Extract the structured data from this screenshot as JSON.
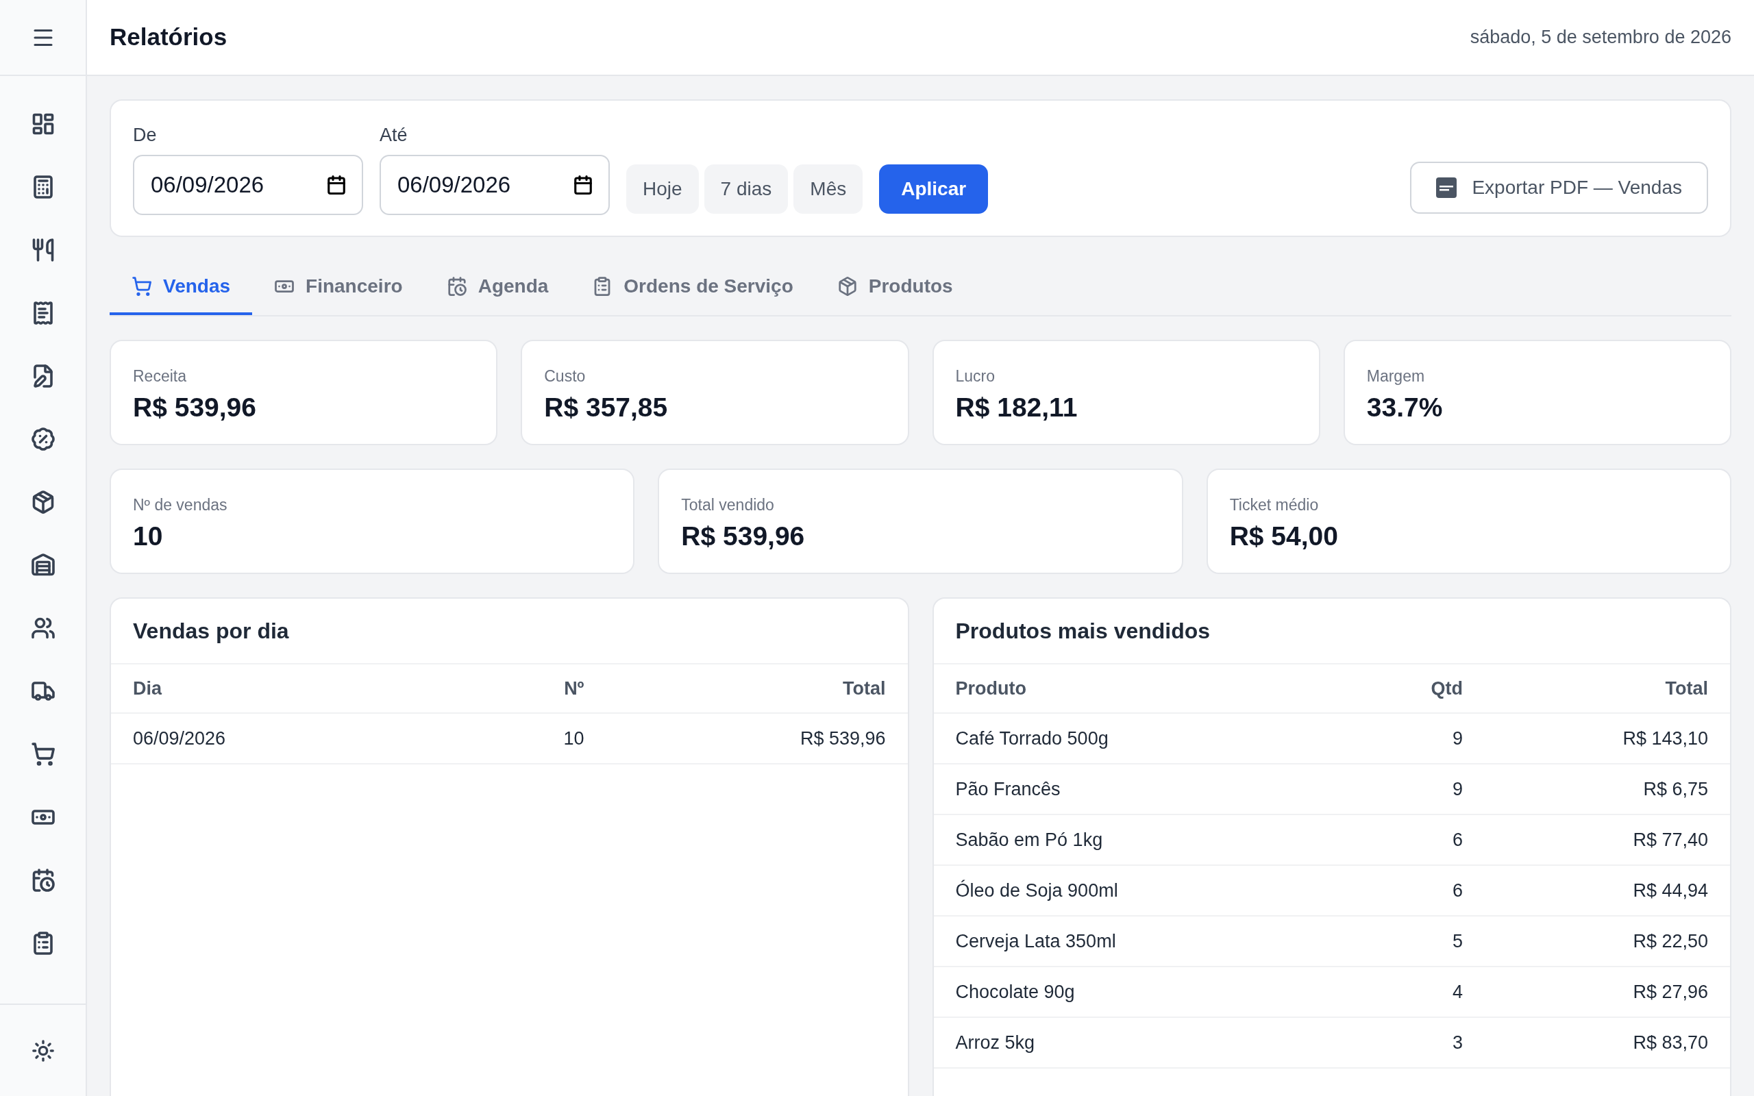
{
  "header": {
    "title": "Relatórios",
    "date": "sábado, 5 de setembro de 2026"
  },
  "filters": {
    "from": {
      "label": "De",
      "value": "06/09/2026"
    },
    "to": {
      "label": "Até",
      "value": "06/09/2026"
    },
    "presets": [
      "Hoje",
      "7 dias",
      "Mês"
    ],
    "apply": "Aplicar",
    "export": "Exportar PDF — Vendas"
  },
  "tabs": [
    {
      "label": "Vendas",
      "kind": "cart",
      "selected": true
    },
    {
      "label": "Financeiro",
      "kind": "money",
      "selected": false
    },
    {
      "label": "Agenda",
      "kind": "calendar",
      "selected": false
    },
    {
      "label": "Ordens de Serviço",
      "kind": "clipboard",
      "selected": false
    },
    {
      "label": "Produtos",
      "kind": "box",
      "selected": false
    }
  ],
  "kpis_top": [
    {
      "label": "Receita",
      "value": "R$ 539,96"
    },
    {
      "label": "Custo",
      "value": "R$ 357,85"
    },
    {
      "label": "Lucro",
      "value": "R$ 182,11"
    },
    {
      "label": "Margem",
      "value": "33.7%"
    }
  ],
  "kpis_bottom": [
    {
      "label": "Nº de vendas",
      "value": "10"
    },
    {
      "label": "Total vendido",
      "value": "R$ 539,96"
    },
    {
      "label": "Ticket médio",
      "value": "R$ 54,00"
    }
  ],
  "sales_by_day": {
    "title": "Vendas por dia",
    "columns": [
      "Dia",
      "Nº",
      "Total"
    ],
    "rows": [
      [
        "06/09/2026",
        "10",
        "R$ 539,96"
      ]
    ]
  },
  "top_products": {
    "title": "Produtos mais vendidos",
    "columns": [
      "Produto",
      "Qtd",
      "Total"
    ],
    "rows": [
      [
        "Café Torrado 500g",
        "9",
        "R$ 143,10"
      ],
      [
        "Pão Francês",
        "9",
        "R$ 6,75"
      ],
      [
        "Sabão em Pó 1kg",
        "6",
        "R$ 77,40"
      ],
      [
        "Óleo de Soja 900ml",
        "6",
        "R$ 44,94"
      ],
      [
        "Cerveja Lata 350ml",
        "5",
        "R$ 22,50"
      ],
      [
        "Chocolate 90g",
        "4",
        "R$ 27,96"
      ],
      [
        "Arroz 5kg",
        "3",
        "R$ 83,70"
      ]
    ]
  }
}
